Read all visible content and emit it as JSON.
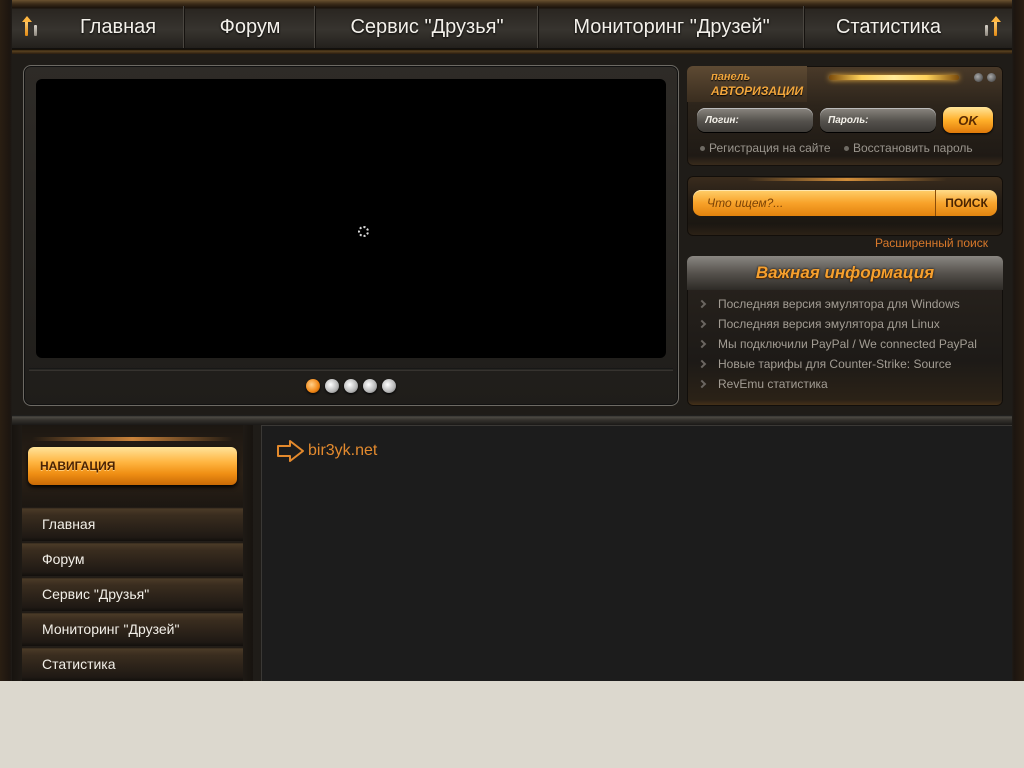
{
  "topnav": {
    "items": [
      {
        "label": "Главная"
      },
      {
        "label": "Форум"
      },
      {
        "label": "Сервис \"Друзья\""
      },
      {
        "label": "Мониторинг \"Друзей\""
      },
      {
        "label": "Статистика"
      }
    ]
  },
  "slider": {
    "dots": 5,
    "active_dot": 1
  },
  "login": {
    "title_line1": "панель",
    "title_line2": "АВТОРИЗАЦИИ",
    "login_placeholder": "Логин:",
    "password_placeholder": "Пароль:",
    "ok_label": "OK",
    "register_link": "Регистрация на сайте",
    "restore_link": "Восстановить пароль"
  },
  "search": {
    "placeholder": "Что ищем?...",
    "button_label": "ПОИСК",
    "advanced_link": "Расширенный поиск"
  },
  "info": {
    "title": "Важная информация",
    "items": [
      {
        "label": "Последняя версия эмулятора для Windows"
      },
      {
        "label": "Последняя версия эмулятора для Linux"
      },
      {
        "label": "Мы подключили PayPal / We connected PayPal"
      },
      {
        "label": "Новые тарифы для Counter-Strike: Source"
      },
      {
        "label": "RevEmu статистика"
      }
    ]
  },
  "sidebar": {
    "heading": "НАВИГАЦИЯ",
    "items": [
      {
        "label": "Главная"
      },
      {
        "label": "Форум"
      },
      {
        "label": "Сервис \"Друзья\""
      },
      {
        "label": "Мониторинг \"Друзей\""
      },
      {
        "label": "Статистика"
      }
    ]
  },
  "content": {
    "breadcrumb": "bir3yk.net"
  },
  "colors": {
    "accent": "#f8a22a",
    "link": "#e38a2e",
    "background": "#1f1c18",
    "page_bottom": "#dcd8ce"
  }
}
